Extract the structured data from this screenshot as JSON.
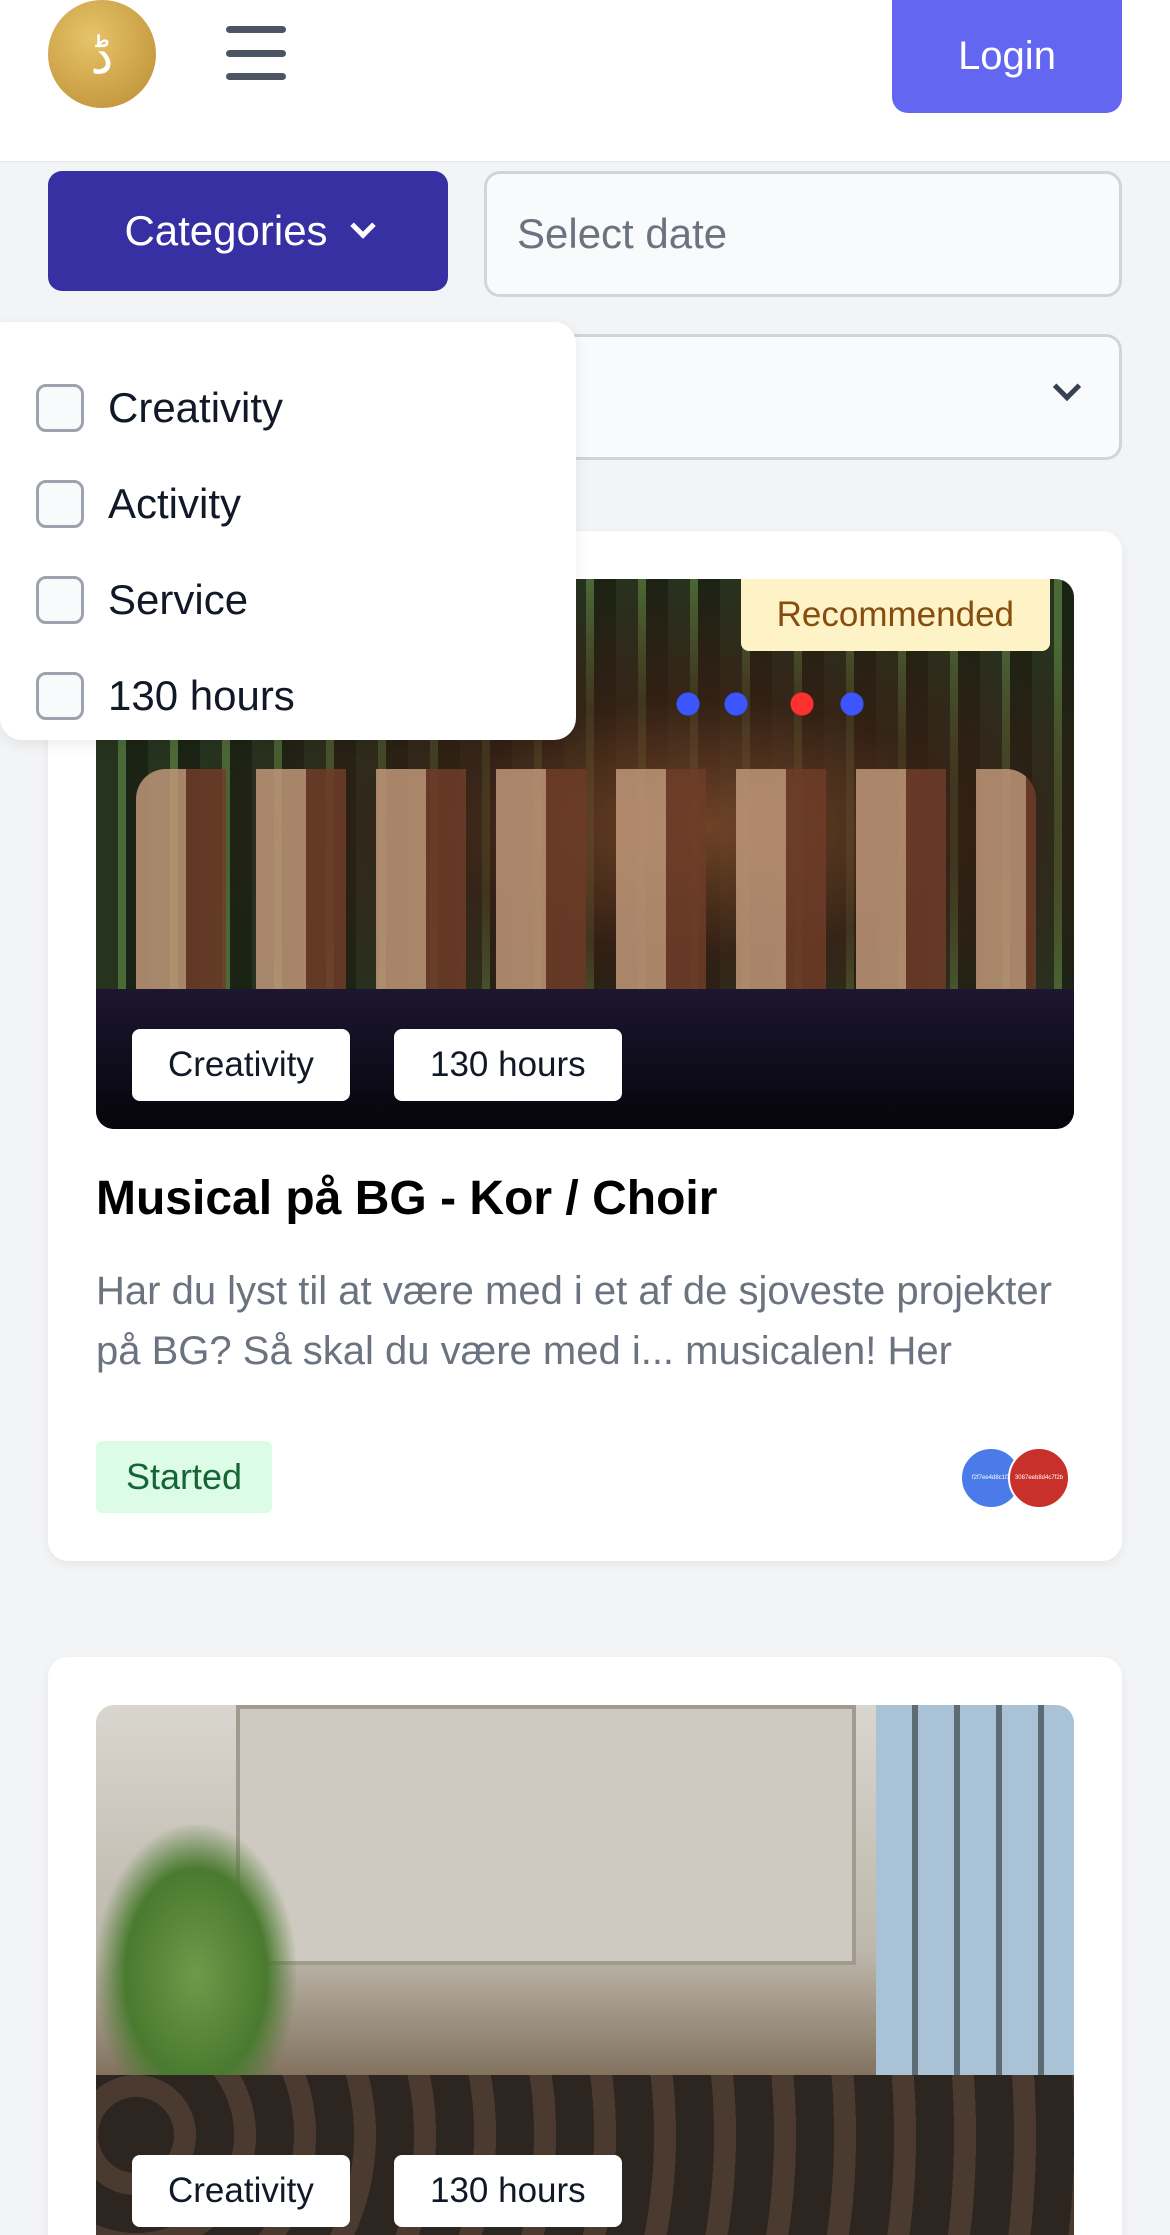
{
  "header": {
    "logo_glyph": "ڈ",
    "login_label": "Login"
  },
  "filters": {
    "categories_label": "Categories",
    "date_placeholder": "Select date",
    "select_value": ""
  },
  "dropdown": {
    "options": [
      {
        "label": "Creativity",
        "checked": false
      },
      {
        "label": "Activity",
        "checked": false
      },
      {
        "label": "Service",
        "checked": false
      },
      {
        "label": "130 hours",
        "checked": false
      }
    ]
  },
  "cards": [
    {
      "badge": "Recommended",
      "tags": [
        "Creativity",
        "130 hours"
      ],
      "title": "Musical på BG - Kor / Choir",
      "description": "Har du lyst til at være med i et af de sjoveste projekter på BG? Så skal du være med i... musicalen! Her samler vi alle de kreative kræfter",
      "status": "Started",
      "avatars": [
        "f2f7ee4d8c1f3",
        "3087eeb8d4c7f2b"
      ]
    },
    {
      "tags": [
        "Creativity",
        "130 hours"
      ]
    }
  ],
  "colors": {
    "primary": "#6366f1",
    "categories_bg": "#3730a3",
    "recommended_bg": "#fef3c7",
    "status_bg": "#dcfce7"
  }
}
